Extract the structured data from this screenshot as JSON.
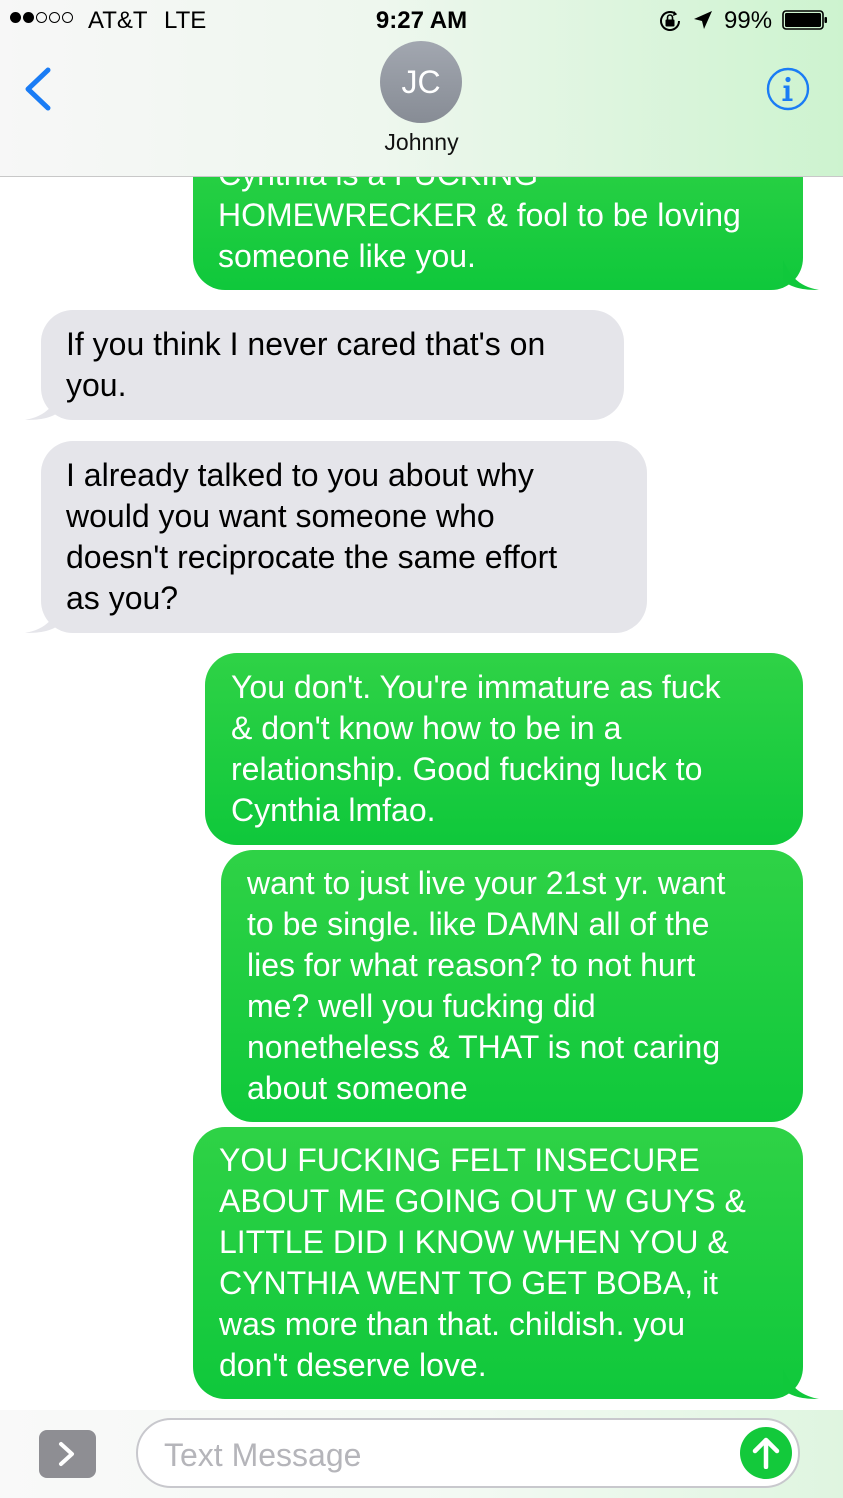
{
  "status_bar": {
    "carrier": "AT&T",
    "network": "LTE",
    "time": "9:27 AM",
    "battery": "99%",
    "signal_bars": 2,
    "signal_total": 5
  },
  "header": {
    "avatar_initials": "JC",
    "contact_name": "Johnny",
    "back_icon": "chevron-left-icon",
    "info_icon": "info-icon"
  },
  "colors": {
    "sent_bubble": "#1fcf41",
    "received_bubble": "#e5e5ea",
    "ios_blue": "#1a7cf5"
  },
  "messages": [
    {
      "direction": "sent",
      "lines": [
        "Cynthia is a FUCKING",
        "HOMEWRECKER & fool to be loving",
        "someone like you."
      ]
    },
    {
      "direction": "received",
      "lines": [
        "If you think I never cared that's on",
        "you."
      ]
    },
    {
      "direction": "received",
      "lines": [
        "I already talked to you about why",
        "would you want someone who",
        "doesn't reciprocate the same effort",
        "as you?"
      ]
    },
    {
      "direction": "sent",
      "lines": [
        "You don't. You're immature as fuck",
        "& don't know how to be in a",
        "relationship. Good fucking luck to",
        "Cynthia lmfao."
      ]
    },
    {
      "direction": "sent",
      "lines": [
        "want to just live your 21st yr. want",
        "to be single. like DAMN all of the",
        "lies for what reason? to not hurt",
        "me? well you fucking did",
        "nonetheless & THAT is not caring",
        "about someone"
      ]
    },
    {
      "direction": "sent",
      "lines": [
        "YOU FUCKING FELT INSECURE",
        "ABOUT ME GOING OUT W GUYS &",
        "LITTLE DID I KNOW WHEN YOU &",
        "CYNTHIA WENT TO GET BOBA, it",
        "was more than that. childish. you",
        "don't deserve love."
      ]
    }
  ],
  "input_bar": {
    "placeholder": "Text Message",
    "apps_icon": "chevron-right-icon",
    "send_icon": "arrow-up-icon"
  }
}
